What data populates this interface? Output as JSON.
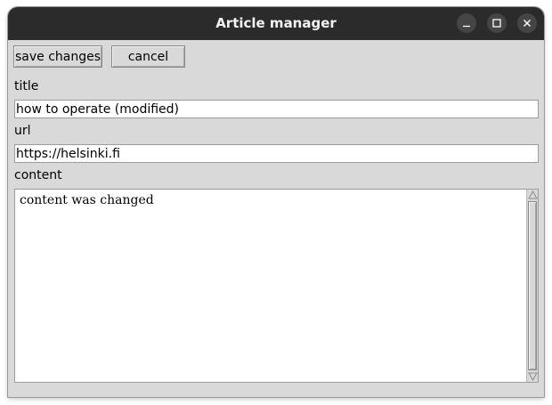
{
  "window": {
    "title": "Article manager"
  },
  "toolbar": {
    "save_label": "save changes",
    "cancel_label": "cancel"
  },
  "form": {
    "title_label": "title",
    "title_value": "how to operate (modified)",
    "url_label": "url",
    "url_value": "https://helsinki.fi",
    "content_label": "content",
    "content_value": "content was changed"
  },
  "icons": {
    "minimize": "minimize-icon",
    "maximize": "maximize-icon",
    "close": "close-icon",
    "scroll_up": "scroll-up-arrow-icon",
    "scroll_down": "scroll-down-arrow-icon"
  },
  "colors": {
    "titlebar": "#2b2b2b",
    "window_bg": "#d9d9d9",
    "field_bg": "#ffffff"
  }
}
